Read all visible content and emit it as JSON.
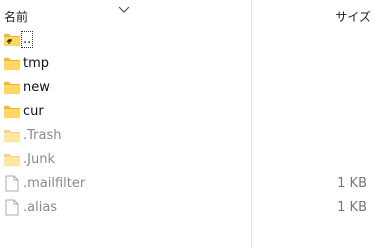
{
  "header": {
    "name_label": "名前",
    "size_label": "サイズ"
  },
  "files": [
    {
      "name": "..",
      "type": "parent-folder",
      "size": ""
    },
    {
      "name": "tmp",
      "type": "folder",
      "size": ""
    },
    {
      "name": "new",
      "type": "folder",
      "size": ""
    },
    {
      "name": "cur",
      "type": "folder",
      "size": ""
    },
    {
      "name": ".Trash",
      "type": "hidden-folder",
      "size": ""
    },
    {
      "name": ".Junk",
      "type": "hidden-folder",
      "size": ""
    },
    {
      "name": ".mailfilter",
      "type": "hidden-file",
      "size": "1 KB"
    },
    {
      "name": ".alias",
      "type": "hidden-file",
      "size": "1 KB"
    }
  ],
  "colors": {
    "folder_fill": "#FFD763",
    "folder_back": "#F2B43A",
    "hidden_text": "#8a8a8a",
    "size_text": "#777777"
  }
}
